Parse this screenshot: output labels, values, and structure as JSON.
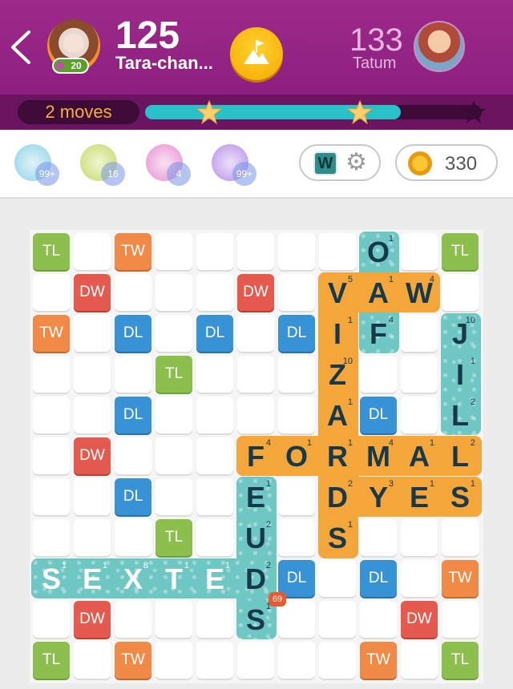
{
  "header": {
    "player": {
      "score": "125",
      "name": "Tara-chan...",
      "level": "20"
    },
    "opponent": {
      "score": "133",
      "name": "Tatum"
    },
    "icons": [
      "back-icon",
      "flag-mountain-icon"
    ]
  },
  "progress": {
    "moves_label": "2 moves",
    "fill_fraction": 0.76,
    "stars": 3,
    "stars_earned": 2
  },
  "powerups": [
    {
      "name": "swap-powerup",
      "count": "99+",
      "color": "#8fd3e6"
    },
    {
      "name": "radar-powerup",
      "count": "16",
      "color": "#c4d96a"
    },
    {
      "name": "shuffle-powerup",
      "count": "4",
      "color": "#e58ed3"
    },
    {
      "name": "hint-powerup",
      "count": "99+",
      "color": "#b68fe8"
    }
  ],
  "toolbar": {
    "word_button_letter": "W",
    "coins": "330"
  },
  "board": {
    "size": 11,
    "bonuses": [
      [
        0,
        0,
        "TL"
      ],
      [
        0,
        2,
        "TW"
      ],
      [
        0,
        10,
        "TL"
      ],
      [
        1,
        1,
        "DW"
      ],
      [
        1,
        5,
        "DW"
      ],
      [
        2,
        0,
        "TW"
      ],
      [
        2,
        2,
        "DL"
      ],
      [
        2,
        4,
        "DL"
      ],
      [
        2,
        6,
        "DL"
      ],
      [
        3,
        3,
        "TL"
      ],
      [
        4,
        2,
        "DL"
      ],
      [
        4,
        8,
        "DL"
      ],
      [
        5,
        1,
        "DW"
      ],
      [
        5,
        9,
        "DW"
      ],
      [
        6,
        2,
        "DL"
      ],
      [
        7,
        3,
        "TL"
      ],
      [
        8,
        6,
        "DL"
      ],
      [
        8,
        8,
        "DL"
      ],
      [
        8,
        10,
        "TW"
      ],
      [
        9,
        1,
        "DW"
      ],
      [
        9,
        9,
        "DW"
      ],
      [
        10,
        0,
        "TL"
      ],
      [
        10,
        2,
        "TW"
      ],
      [
        10,
        8,
        "TW"
      ],
      [
        10,
        10,
        "TL"
      ]
    ],
    "tiles": [
      {
        "r": 0,
        "c": 8,
        "l": "O",
        "p": "1"
      },
      {
        "r": 1,
        "c": 7,
        "l": "V",
        "p": "5"
      },
      {
        "r": 1,
        "c": 8,
        "l": "A",
        "p": "1"
      },
      {
        "r": 1,
        "c": 9,
        "l": "W",
        "p": "4"
      },
      {
        "r": 2,
        "c": 7,
        "l": "I",
        "p": "1"
      },
      {
        "r": 2,
        "c": 8,
        "l": "F",
        "p": "4"
      },
      {
        "r": 2,
        "c": 10,
        "l": "J",
        "p": "10"
      },
      {
        "r": 3,
        "c": 7,
        "l": "Z",
        "p": "10"
      },
      {
        "r": 3,
        "c": 10,
        "l": "I",
        "p": "1"
      },
      {
        "r": 4,
        "c": 7,
        "l": "A",
        "p": "1"
      },
      {
        "r": 4,
        "c": 10,
        "l": "L",
        "p": "2"
      },
      {
        "r": 5,
        "c": 5,
        "l": "F",
        "p": "4"
      },
      {
        "r": 5,
        "c": 6,
        "l": "O",
        "p": "1"
      },
      {
        "r": 5,
        "c": 7,
        "l": "R",
        "p": "1"
      },
      {
        "r": 5,
        "c": 8,
        "l": "M",
        "p": "4"
      },
      {
        "r": 5,
        "c": 9,
        "l": "A",
        "p": "1"
      },
      {
        "r": 5,
        "c": 10,
        "l": "L",
        "p": "2"
      },
      {
        "r": 6,
        "c": 5,
        "l": "E",
        "p": "1"
      },
      {
        "r": 6,
        "c": 7,
        "l": "D",
        "p": "2"
      },
      {
        "r": 6,
        "c": 8,
        "l": "Y",
        "p": "3"
      },
      {
        "r": 6,
        "c": 9,
        "l": "E",
        "p": "1"
      },
      {
        "r": 6,
        "c": 10,
        "l": "S",
        "p": "1"
      },
      {
        "r": 7,
        "c": 5,
        "l": "U",
        "p": "2"
      },
      {
        "r": 7,
        "c": 7,
        "l": "S",
        "p": "1"
      },
      {
        "r": 8,
        "c": 0,
        "l": "S",
        "p": "1"
      },
      {
        "r": 8,
        "c": 1,
        "l": "E",
        "p": "1"
      },
      {
        "r": 8,
        "c": 2,
        "l": "X",
        "p": "8"
      },
      {
        "r": 8,
        "c": 3,
        "l": "T",
        "p": "1"
      },
      {
        "r": 8,
        "c": 4,
        "l": "E",
        "p": "1"
      },
      {
        "r": 8,
        "c": 5,
        "l": "D",
        "p": "2"
      },
      {
        "r": 9,
        "c": 5,
        "l": "S",
        "p": "1"
      }
    ],
    "word_score_badge": "69"
  }
}
